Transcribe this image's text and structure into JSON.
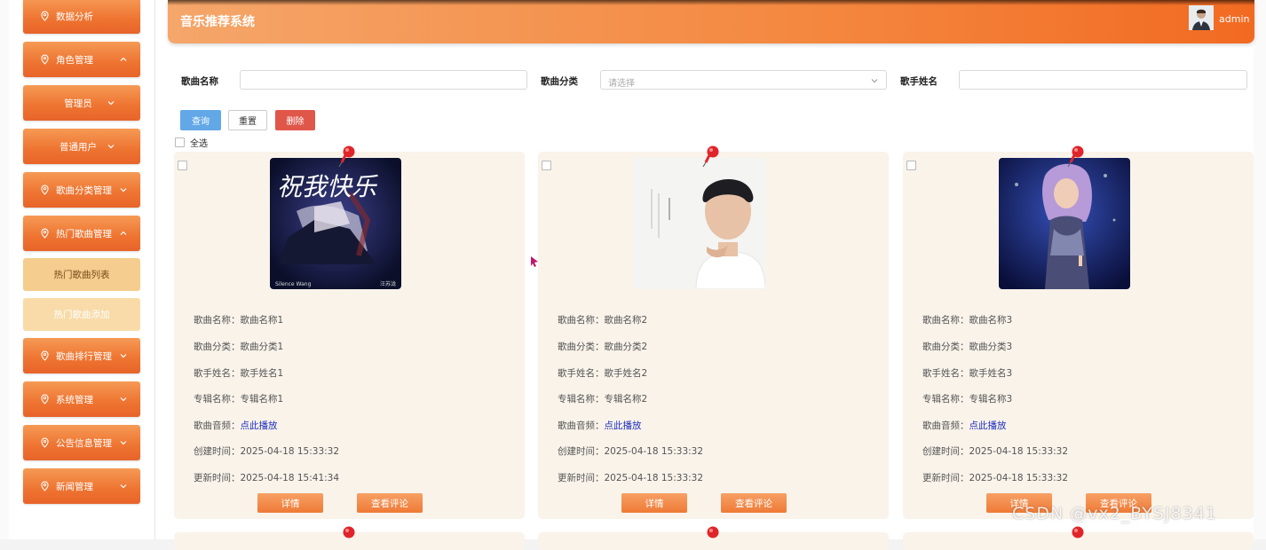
{
  "app": {
    "title": "音乐推荐系统",
    "user": "admin"
  },
  "colors": {
    "accent": "#ee7330",
    "card_bg": "#f9f3ea",
    "link": "#1f2fbf",
    "query": "#62a8e6",
    "delete": "#e0574a"
  },
  "sidebar": {
    "items": [
      {
        "label": "数据分析",
        "icon": "location-pin-icon",
        "chevron": "",
        "kind": "top"
      },
      {
        "label": "角色管理",
        "icon": "location-pin-icon",
        "chevron": "up",
        "kind": "top"
      },
      {
        "label": "管理员",
        "icon": "",
        "chevron": "down",
        "kind": "sub"
      },
      {
        "label": "普通用户",
        "icon": "",
        "chevron": "down",
        "kind": "sub"
      },
      {
        "label": "歌曲分类管理",
        "icon": "location-pin-icon",
        "chevron": "down",
        "kind": "top"
      },
      {
        "label": "热门歌曲管理",
        "icon": "location-pin-icon",
        "chevron": "up",
        "kind": "top"
      },
      {
        "label": "热门歌曲列表",
        "icon": "",
        "chevron": "",
        "kind": "active-sub"
      },
      {
        "label": "热门歌曲添加",
        "icon": "",
        "chevron": "",
        "kind": "inactive-sub"
      },
      {
        "label": "歌曲排行管理",
        "icon": "location-pin-icon",
        "chevron": "down",
        "kind": "top"
      },
      {
        "label": "系统管理",
        "icon": "location-pin-icon",
        "chevron": "down",
        "kind": "top"
      },
      {
        "label": "公告信息管理",
        "icon": "location-pin-icon",
        "chevron": "down",
        "kind": "top"
      },
      {
        "label": "新闻管理",
        "icon": "location-pin-icon",
        "chevron": "down",
        "kind": "top"
      }
    ]
  },
  "filters": {
    "song_name_label": "歌曲名称",
    "song_name_value": "",
    "category_label": "歌曲分类",
    "category_placeholder": "请选择",
    "singer_label": "歌手姓名",
    "singer_value": ""
  },
  "actions": {
    "query": "查询",
    "reset": "重置",
    "delete": "删除",
    "select_all": "全选"
  },
  "field_labels": {
    "name": "歌曲名称：",
    "category": "歌曲分类：",
    "singer": "歌手姓名：",
    "album": "专辑名称：",
    "audio": "歌曲音频：",
    "created": "创建时间：",
    "updated": "更新时间："
  },
  "card_buttons": {
    "detail": "详情",
    "comments": "查看评论"
  },
  "songs": [
    {
      "name": "歌曲名称1",
      "category": "歌曲分类1",
      "singer": "歌手姓名1",
      "album": "专辑名称1",
      "audio": "点此播放",
      "created": "2025-04-18 15:33:32",
      "updated": "2025-04-18 15:41:34",
      "cover_text": "祝我快乐",
      "cover_caption_left": "Silence Wang",
      "cover_caption_right": "汪苏泷"
    },
    {
      "name": "歌曲名称2",
      "category": "歌曲分类2",
      "singer": "歌手姓名2",
      "album": "专辑名称2",
      "audio": "点此播放",
      "created": "2025-04-18 15:33:32",
      "updated": "2025-04-18 15:33:32"
    },
    {
      "name": "歌曲名称3",
      "category": "歌曲分类3",
      "singer": "歌手姓名3",
      "album": "专辑名称3",
      "audio": "点此播放",
      "created": "2025-04-18 15:33:32",
      "updated": "2025-04-18 15:33:32"
    }
  ],
  "watermark": "CSDN @vx2_BYSJ8341"
}
